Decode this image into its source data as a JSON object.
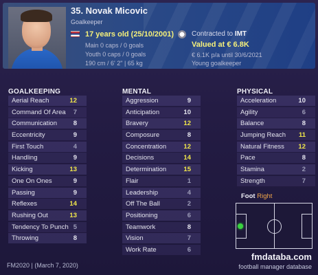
{
  "player": {
    "name": "35. Novak Micovic",
    "position": "Goalkeeper",
    "age": "17 years old (25/10/2001)",
    "main_caps": "Main 0 caps / 0 goals",
    "youth_caps": "Youth 0 caps / 0 goals",
    "physique": "190 cm / 6' 2\" | 65 kg",
    "contract_prefix": "Contracted to",
    "club": "IMT",
    "value": "Valued at € 6.8K",
    "wage": "€ 6.1K p/a until 30/6/2021",
    "status": "Young goalkeeper",
    "colors": {
      "header": "#2b4a86",
      "highlight": "#f5f07a"
    }
  },
  "goalkeeping": {
    "title": "GOALKEEPING",
    "attributes": [
      {
        "label": "Aerial Reach",
        "value": "12"
      },
      {
        "label": "Command Of Area",
        "value": "7"
      },
      {
        "label": "Communication",
        "value": "8"
      },
      {
        "label": "Eccentricity",
        "value": "9"
      },
      {
        "label": "First Touch",
        "value": "4"
      },
      {
        "label": "Handling",
        "value": "9"
      },
      {
        "label": "Kicking",
        "value": "13"
      },
      {
        "label": "One On Ones",
        "value": "9"
      },
      {
        "label": "Passing",
        "value": "9"
      },
      {
        "label": "Reflexes",
        "value": "14"
      },
      {
        "label": "Rushing Out",
        "value": "13"
      },
      {
        "label": "Tendency To Punch",
        "value": "5"
      },
      {
        "label": "Throwing",
        "value": "8"
      }
    ]
  },
  "mental": {
    "title": "MENTAL",
    "attributes": [
      {
        "label": "Aggression",
        "value": "9"
      },
      {
        "label": "Anticipation",
        "value": "10"
      },
      {
        "label": "Bravery",
        "value": "12"
      },
      {
        "label": "Composure",
        "value": "8"
      },
      {
        "label": "Concentration",
        "value": "12"
      },
      {
        "label": "Decisions",
        "value": "14"
      },
      {
        "label": "Determination",
        "value": "15"
      },
      {
        "label": "Flair",
        "value": "1"
      },
      {
        "label": "Leadership",
        "value": "4"
      },
      {
        "label": "Off The Ball",
        "value": "2"
      },
      {
        "label": "Positioning",
        "value": "6"
      },
      {
        "label": "Teamwork",
        "value": "8"
      },
      {
        "label": "Vision",
        "value": "7"
      },
      {
        "label": "Work Rate",
        "value": "6"
      }
    ]
  },
  "physical": {
    "title": "PHYSICAL",
    "attributes": [
      {
        "label": "Acceleration",
        "value": "10"
      },
      {
        "label": "Agility",
        "value": "6"
      },
      {
        "label": "Balance",
        "value": "8"
      },
      {
        "label": "Jumping Reach",
        "value": "11"
      },
      {
        "label": "Natural Fitness",
        "value": "12"
      },
      {
        "label": "Pace",
        "value": "8"
      },
      {
        "label": "Stamina",
        "value": "2"
      },
      {
        "label": "Strength",
        "value": "7"
      }
    ]
  },
  "foot": {
    "label": "Foot",
    "side": "Right"
  },
  "footer": {
    "version": "FM2020 | (March 7, 2020)",
    "brand": "fmdataba.com",
    "brand_sub": "football manager database"
  }
}
